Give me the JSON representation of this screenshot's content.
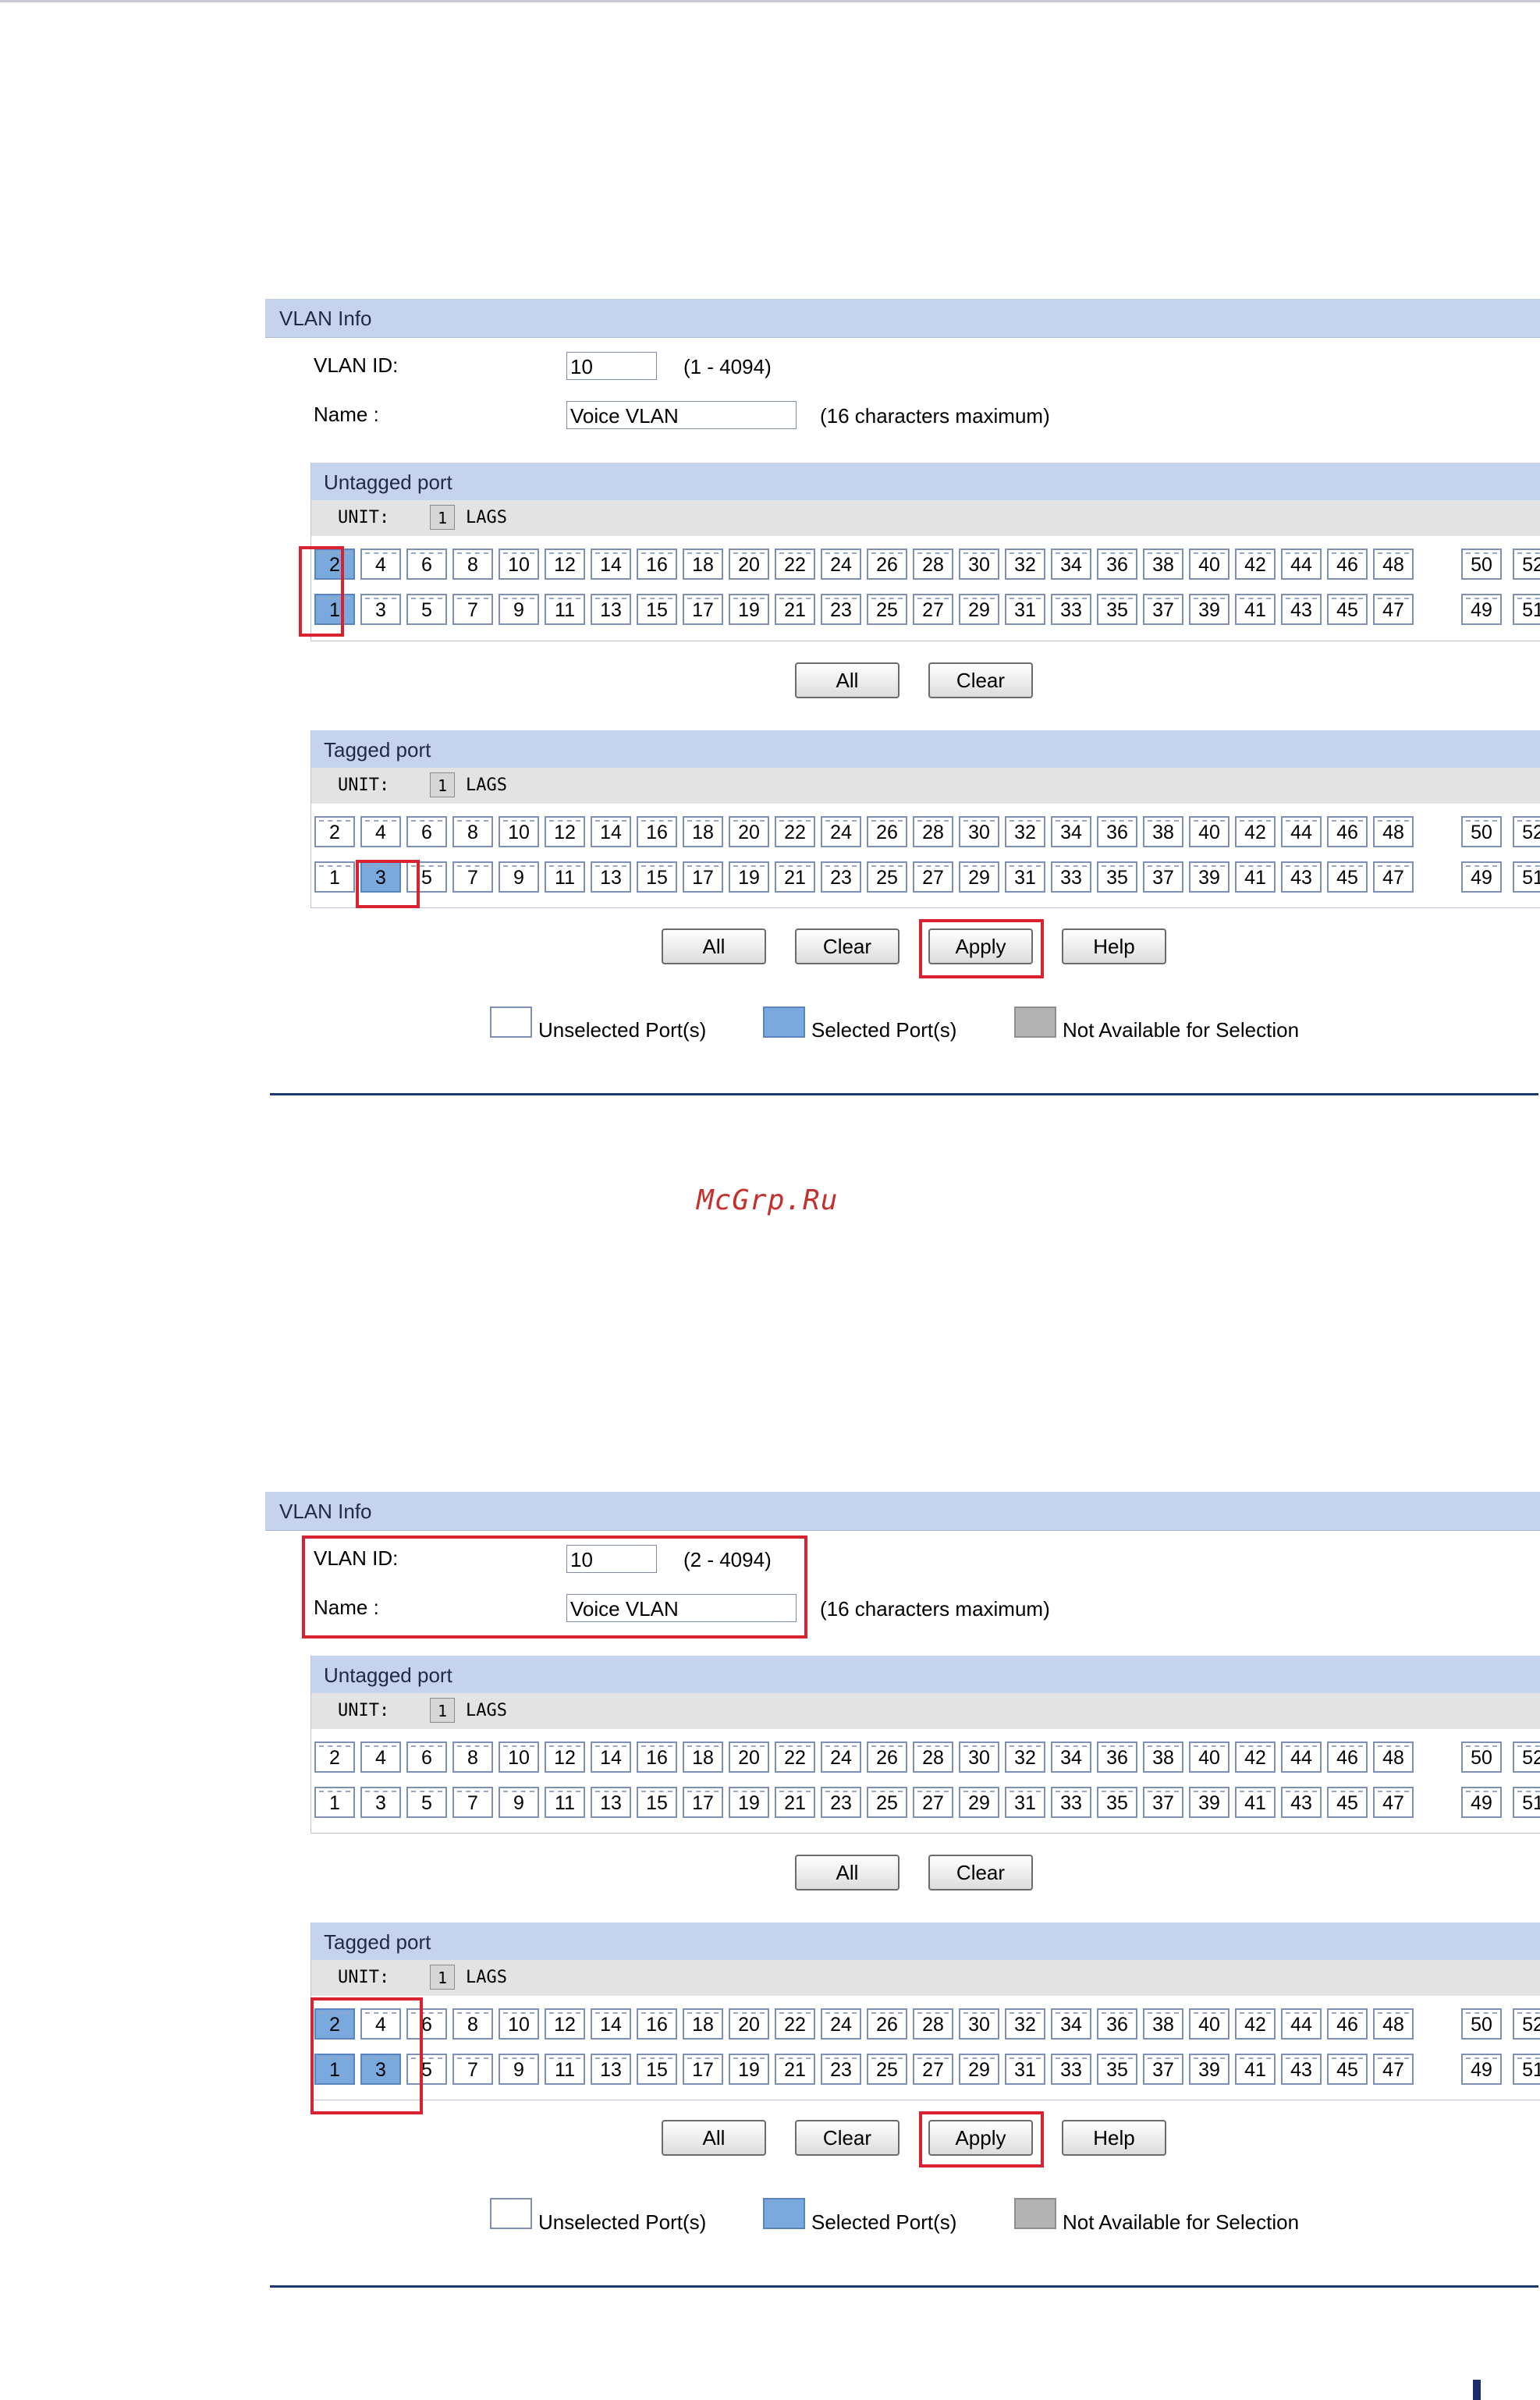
{
  "watermark": "McGrp.Ru",
  "legend": {
    "unselected": "Unselected Port(s)",
    "selected": "Selected Port(s)",
    "na": "Not Available for Selection"
  },
  "panels": [
    {
      "vlan_info": {
        "title": "VLAN Info",
        "vlan_id_label": "VLAN ID:",
        "vlan_id_value": "10",
        "vlan_id_range": "(1 - 4094)",
        "name_label": "Name :",
        "name_value": "Voice VLAN",
        "name_hint": "(16 characters maximum)"
      },
      "untagged": {
        "title": "Untagged port",
        "unit_label": "UNIT:",
        "unit_value": "1",
        "lags_label": "LAGS",
        "selected_ports": [
          1,
          2
        ]
      },
      "tagged": {
        "title": "Tagged port",
        "unit_label": "UNIT:",
        "unit_value": "1",
        "lags_label": "LAGS",
        "selected_ports": [
          3
        ]
      },
      "buttons": {
        "all": "All",
        "clear": "Clear",
        "apply": "Apply",
        "help": "Help"
      }
    },
    {
      "vlan_info": {
        "title": "VLAN Info",
        "vlan_id_label": "VLAN ID:",
        "vlan_id_value": "10",
        "vlan_id_range": "(2 - 4094)",
        "name_label": "Name :",
        "name_value": "Voice VLAN",
        "name_hint": "(16 characters maximum)"
      },
      "untagged": {
        "title": "Untagged port",
        "unit_label": "UNIT:",
        "unit_value": "1",
        "lags_label": "LAGS",
        "selected_ports": []
      },
      "tagged": {
        "title": "Tagged port",
        "unit_label": "UNIT:",
        "unit_value": "1",
        "lags_label": "LAGS",
        "selected_ports": [
          1,
          2,
          3
        ]
      },
      "buttons": {
        "all": "All",
        "clear": "Clear",
        "apply": "Apply",
        "help": "Help"
      }
    }
  ],
  "ports": {
    "even": [
      "2",
      "4",
      "6",
      "8",
      "10",
      "12",
      "14",
      "16",
      "18",
      "20",
      "22",
      "24",
      "26",
      "28",
      "30",
      "32",
      "34",
      "36",
      "38",
      "40",
      "42",
      "44",
      "46",
      "48",
      "50",
      "52"
    ],
    "odd": [
      "1",
      "3",
      "5",
      "7",
      "9",
      "11",
      "13",
      "15",
      "17",
      "19",
      "21",
      "23",
      "25",
      "27",
      "29",
      "31",
      "33",
      "35",
      "37",
      "39",
      "41",
      "43",
      "45",
      "47",
      "49",
      "51"
    ]
  },
  "colors": {
    "header_bg": "#c5d3ef",
    "selected_port": "#7aa9dd",
    "highlight": "#d9222f",
    "unit_row_bg": "#e3e3e3"
  }
}
